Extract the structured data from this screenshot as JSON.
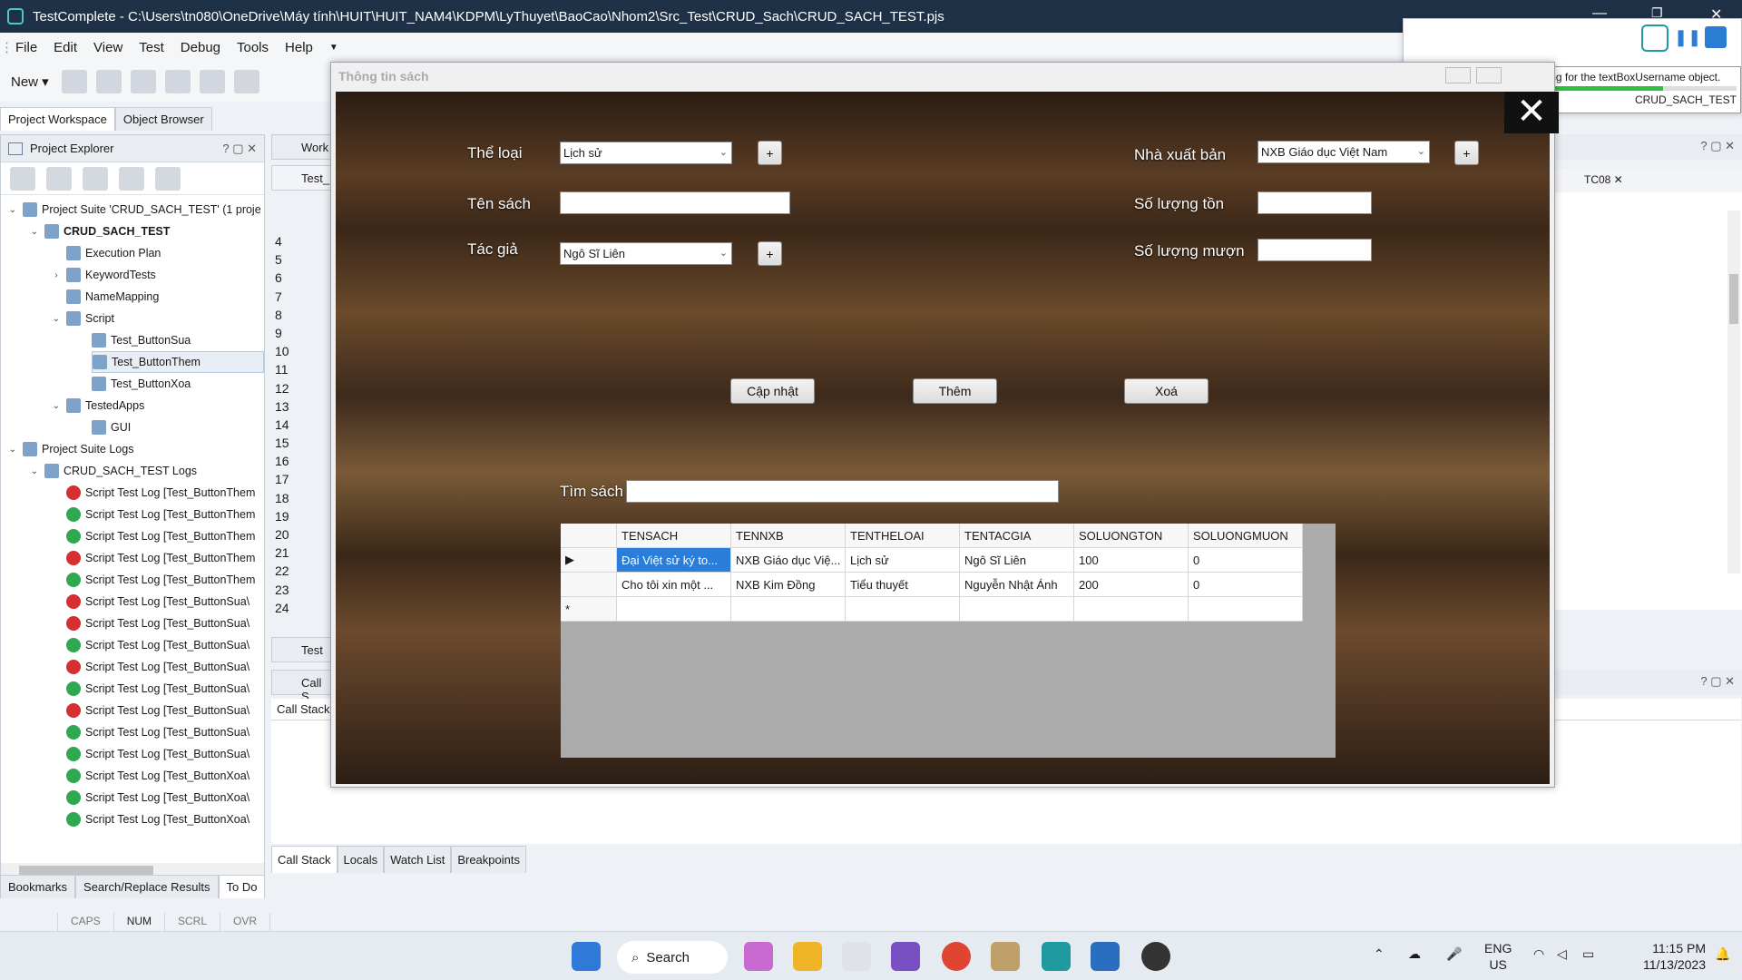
{
  "window": {
    "title": "TestComplete - C:\\Users\\tn080\\OneDrive\\Máy tính\\HUIT\\HUIT_NAM4\\KDPM\\LyThuyet\\BaoCao\\Nhom2\\Src_Test\\CRUD_Sach\\CRUD_SACH_TEST.pjs"
  },
  "menu": [
    "File",
    "Edit",
    "View",
    "Test",
    "Debug",
    "Tools",
    "Help"
  ],
  "toolbar": {
    "new_label": "New"
  },
  "left_tabs": {
    "workspace": "Project Workspace",
    "browser": "Object Browser"
  },
  "explorer": {
    "title": "Project Explorer",
    "suite": "Project Suite 'CRUD_SACH_TEST' (1 proje",
    "project": "CRUD_SACH_TEST",
    "items": [
      "Execution Plan",
      "KeywordTests",
      "NameMapping",
      "Script",
      "Test_ButtonSua",
      "Test_ButtonThem",
      "Test_ButtonXoa",
      "TestedApps",
      "GUI"
    ],
    "logs_root": "Project Suite Logs",
    "logs_project": "CRUD_SACH_TEST Logs",
    "logs": [
      {
        "text": "Script Test Log [Test_ButtonThem",
        "status": "fail"
      },
      {
        "text": "Script Test Log [Test_ButtonThem",
        "status": "pass"
      },
      {
        "text": "Script Test Log [Test_ButtonThem",
        "status": "pass"
      },
      {
        "text": "Script Test Log [Test_ButtonThem",
        "status": "fail"
      },
      {
        "text": "Script Test Log [Test_ButtonThem",
        "status": "pass"
      },
      {
        "text": "Script Test Log [Test_ButtonSua\\",
        "status": "fail"
      },
      {
        "text": "Script Test Log [Test_ButtonSua\\",
        "status": "fail"
      },
      {
        "text": "Script Test Log [Test_ButtonSua\\",
        "status": "pass"
      },
      {
        "text": "Script Test Log [Test_ButtonSua\\",
        "status": "fail"
      },
      {
        "text": "Script Test Log [Test_ButtonSua\\",
        "status": "pass"
      },
      {
        "text": "Script Test Log [Test_ButtonSua\\",
        "status": "fail"
      },
      {
        "text": "Script Test Log [Test_ButtonSua\\",
        "status": "pass"
      },
      {
        "text": "Script Test Log [Test_ButtonSua\\",
        "status": "pass"
      },
      {
        "text": "Script Test Log [Test_ButtonXoa\\",
        "status": "pass"
      },
      {
        "text": "Script Test Log [Test_ButtonXoa\\",
        "status": "pass"
      },
      {
        "text": "Script Test Log [Test_ButtonXoa\\",
        "status": "pass"
      }
    ]
  },
  "center": {
    "work_tab": "Work",
    "test_tab": "Test_",
    "line_numbers": [
      "4",
      "5",
      "6",
      "7",
      "8",
      "9",
      "10",
      "11",
      "12",
      "13",
      "14",
      "15",
      "16",
      "17",
      "18",
      "19",
      "20",
      "21",
      "22",
      "23",
      "24"
    ],
    "test_panel": "Test",
    "call_panel": "Call S",
    "call_stack_header": "Call Stack",
    "bottom_tabs": [
      "Call Stack",
      "Locals",
      "Watch List",
      "Breakpoints"
    ]
  },
  "bottom_left_tabs": [
    "Bookmarks",
    "Search/Replace Results",
    "To Do"
  ],
  "status": [
    "CAPS",
    "NUM",
    "SCRL",
    "OVR"
  ],
  "right_tab": "TC08",
  "runner": {
    "message": "Waiting for the textBoxUsername object.",
    "project": "CRUD_SACH_TEST",
    "progress_percent": 65
  },
  "form": {
    "title": "Thông tin sách",
    "close_glyph": "✕",
    "labels": {
      "theloai": "Thể loại",
      "tensach": "Tên sách",
      "tacgia": "Tác giả",
      "nxb": "Nhà xuất bản",
      "slton": "Số lượng tồn",
      "slmuon": "Số lượng mượn",
      "timsach": "Tìm sách"
    },
    "values": {
      "theloai": "Lịch sử",
      "tacgia": "Ngô Sĩ Liên",
      "nxb": "NXB Giáo dục Việt Nam"
    },
    "plus": "+",
    "buttons": {
      "capnhat": "Cập nhật",
      "them": "Thêm",
      "xoa": "Xoá"
    },
    "grid": {
      "headers": [
        "TENSACH",
        "TENNXB",
        "TENTHELOAI",
        "TENTACGIA",
        "SOLUONGTON",
        "SOLUONGMUON"
      ],
      "rows": [
        [
          "Đại Việt sử ký to...",
          "NXB Giáo dục Việ...",
          "Lịch sử",
          "Ngô Sĩ Liên",
          "100",
          "0"
        ],
        [
          "Cho tôi xin một ...",
          "NXB Kim Đồng",
          "Tiểu thuyết",
          "Nguyễn Nhật Ánh",
          "200",
          "0"
        ]
      ],
      "new_row_marker": "*",
      "current_row_marker": "▶"
    }
  },
  "taskbar": {
    "search": "Search",
    "lang1": "ENG",
    "lang2": "US",
    "time": "11:15 PM",
    "date": "11/13/2023"
  }
}
